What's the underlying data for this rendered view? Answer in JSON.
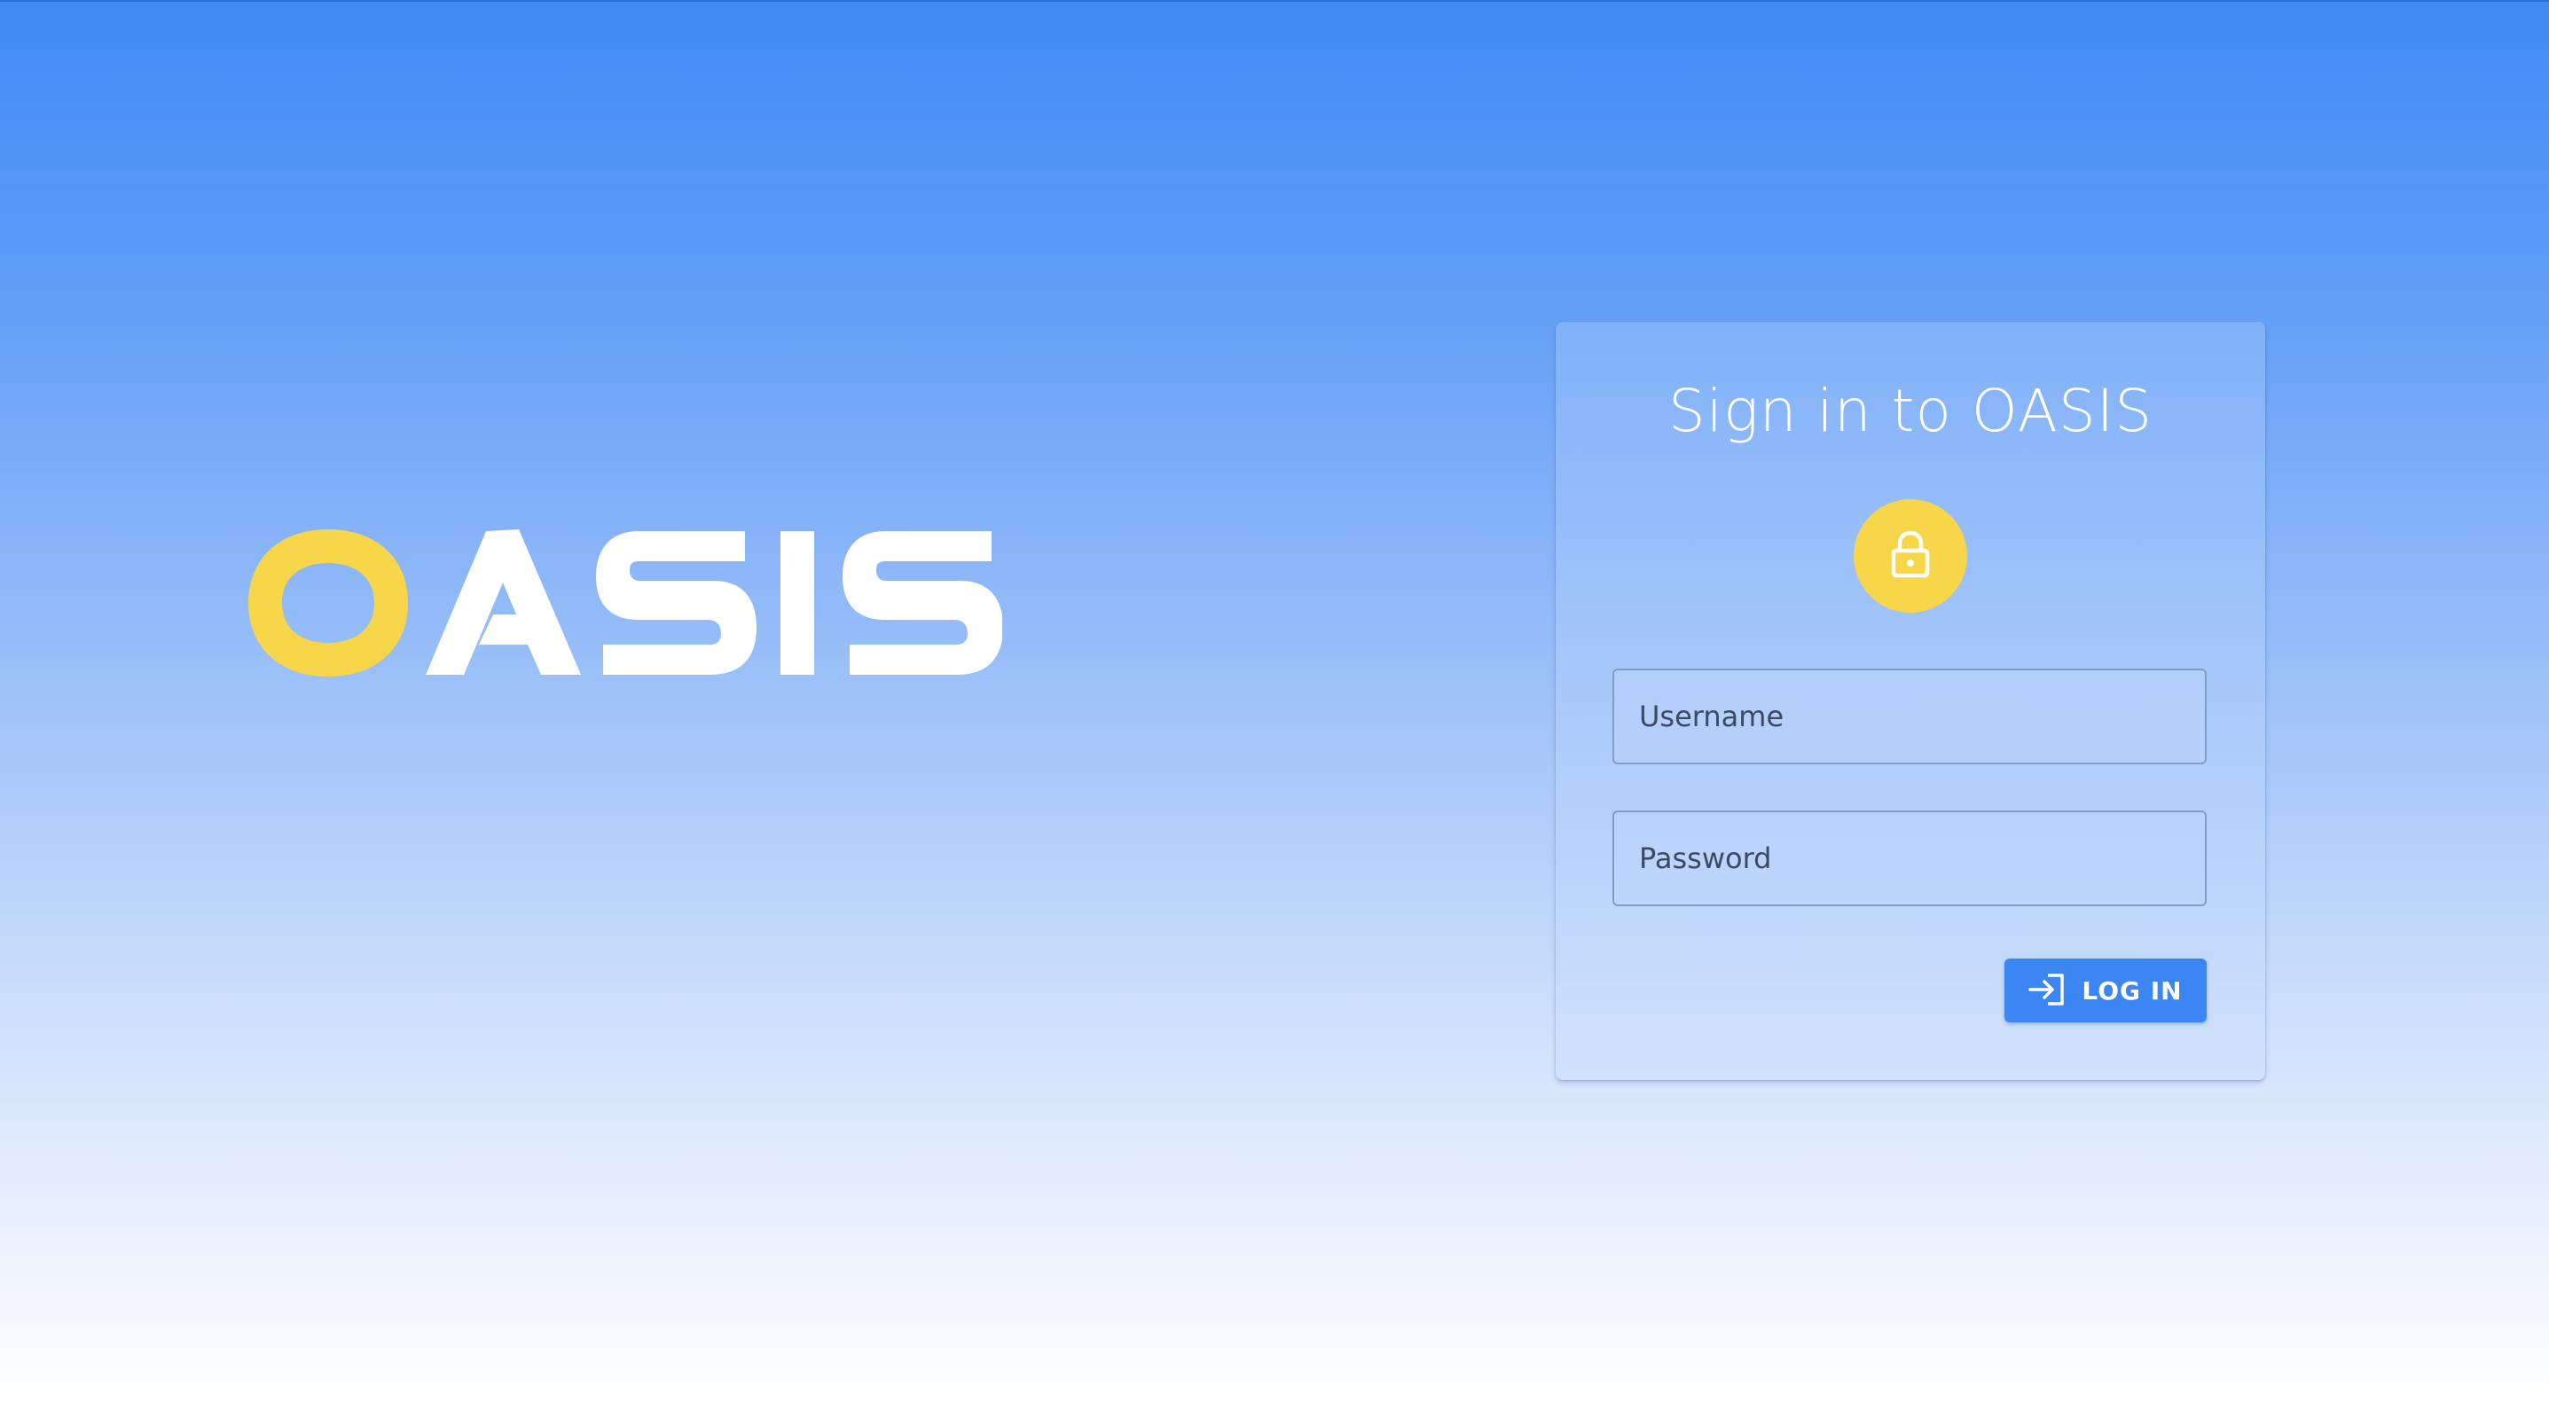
{
  "logo": {
    "first_letter": "O",
    "rest": "ASIS",
    "colors": {
      "accent": "#f7d64a",
      "text": "#ffffff"
    }
  },
  "login_card": {
    "title": "Sign in to OASIS",
    "lock_icon": "lock-icon",
    "username": {
      "placeholder": "Username",
      "value": ""
    },
    "password": {
      "placeholder": "Password",
      "value": ""
    },
    "login_button": {
      "label": "LOG IN",
      "icon": "login-icon"
    }
  },
  "colors": {
    "background_top": "#408af5",
    "background_bottom": "#ffffff",
    "accent_yellow": "#f7d64a",
    "button_blue": "#3b86f2"
  }
}
